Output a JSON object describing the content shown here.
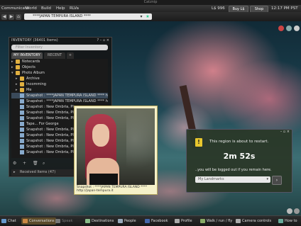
{
  "window": {
    "title": "Catznip"
  },
  "menubar": {
    "items": [
      "Communicate",
      "World",
      "Build",
      "Help",
      "RLVa"
    ],
    "balance": "L$ 996",
    "buy_label": "Buy L$",
    "shop_label": "Shop",
    "time": "12:17 PM PST"
  },
  "navbar": {
    "location": "****JAPAN TEMPURA ISLAND ****"
  },
  "inventory": {
    "title": "INVENTORY (36401 Items)",
    "controls": "? – ▫ ×",
    "filter_placeholder": "Filter Inventory",
    "tabs": [
      "MY INVENTORY",
      "RECENT",
      "+"
    ],
    "rows": [
      {
        "label": "Notecards",
        "kind": "folder",
        "indent": 1,
        "expanded": false
      },
      {
        "label": "Objects",
        "kind": "folder",
        "indent": 1,
        "expanded": false
      },
      {
        "label": "Photo Album",
        "kind": "folder",
        "indent": 1,
        "expanded": true
      },
      {
        "label": "Archive",
        "kind": "folder",
        "indent": 2,
        "expanded": false
      },
      {
        "label": "Incomming",
        "kind": "folder",
        "indent": 2,
        "expanded": false
      },
      {
        "label": "Me",
        "kind": "folder",
        "indent": 2,
        "expanded": false
      },
      {
        "label": "Snapshot : ****JAPAN TEMPURA ISLAND **** http",
        "kind": "snap",
        "indent": 2,
        "selected": true
      },
      {
        "label": "Snapshot : ****JAPAN TEMPURA ISLAND **** http",
        "kind": "snap",
        "indent": 2
      },
      {
        "label": "Snapshot : New Ombria, Plan",
        "kind": "snap",
        "indent": 2
      },
      {
        "label": "Snapshot : New Ombria, Plan",
        "kind": "snap",
        "indent": 2
      },
      {
        "label": "Snapshot : New Ombria, Plan",
        "kind": "snap",
        "indent": 2
      },
      {
        "label": "Tape... For George",
        "kind": "snap",
        "indent": 2
      },
      {
        "label": "Snapshot : New Ombria, Plan",
        "kind": "snap",
        "indent": 2
      },
      {
        "label": "Snapshot : New Ombria, Plan",
        "kind": "snap",
        "indent": 2
      },
      {
        "label": "Snapshot : New Ombria, Plan",
        "kind": "snap",
        "indent": 2
      },
      {
        "label": "Snapshot : New Ombria, Plan",
        "kind": "snap",
        "indent": 2
      },
      {
        "label": "Snapshot : New Ombria, Plan",
        "kind": "snap",
        "indent": 2
      }
    ],
    "tool_icons": [
      "gear-icon",
      "plus-icon",
      "trash-icon",
      "search-icon"
    ],
    "received": "Received Items (47)"
  },
  "preview": {
    "caption_line1": "Snapshot : ****JAPAN TEMPURA ISLAND ****",
    "caption_line2": "http://japan-tempura.it"
  },
  "restart": {
    "controls": "– ▫ ×",
    "message": "This region is about to restart.",
    "countdown": "2m 52s",
    "logout_text": "..you will be logged out if you remain here.",
    "landmark_placeholder": "My Landmarks",
    "go_label": "›",
    "accent": "#e8c72e"
  },
  "bottombar": {
    "items": [
      {
        "label": "Chat",
        "icon": "chat-icon",
        "active": false,
        "dim": false
      },
      {
        "label": "Conversations",
        "icon": "conversations-icon",
        "active": true,
        "dim": false
      },
      {
        "label": "Speak",
        "icon": "speak-icon",
        "active": false,
        "dim": true
      },
      {
        "label": "Destinations",
        "icon": "destinations-icon",
        "active": false,
        "dim": false
      },
      {
        "label": "People",
        "icon": "people-icon",
        "active": false,
        "dim": false
      },
      {
        "label": "Facebook",
        "icon": "facebook-icon",
        "active": false,
        "dim": false
      },
      {
        "label": "Profile",
        "icon": "profile-icon",
        "active": false,
        "dim": false
      },
      {
        "label": "Walk / run / fly",
        "icon": "walk-icon",
        "active": false,
        "dim": false
      },
      {
        "label": "Camera controls",
        "icon": "camera-icon",
        "active": false,
        "dim": false
      },
      {
        "label": "How to",
        "icon": "howto-icon",
        "active": false,
        "dim": false
      }
    ]
  }
}
